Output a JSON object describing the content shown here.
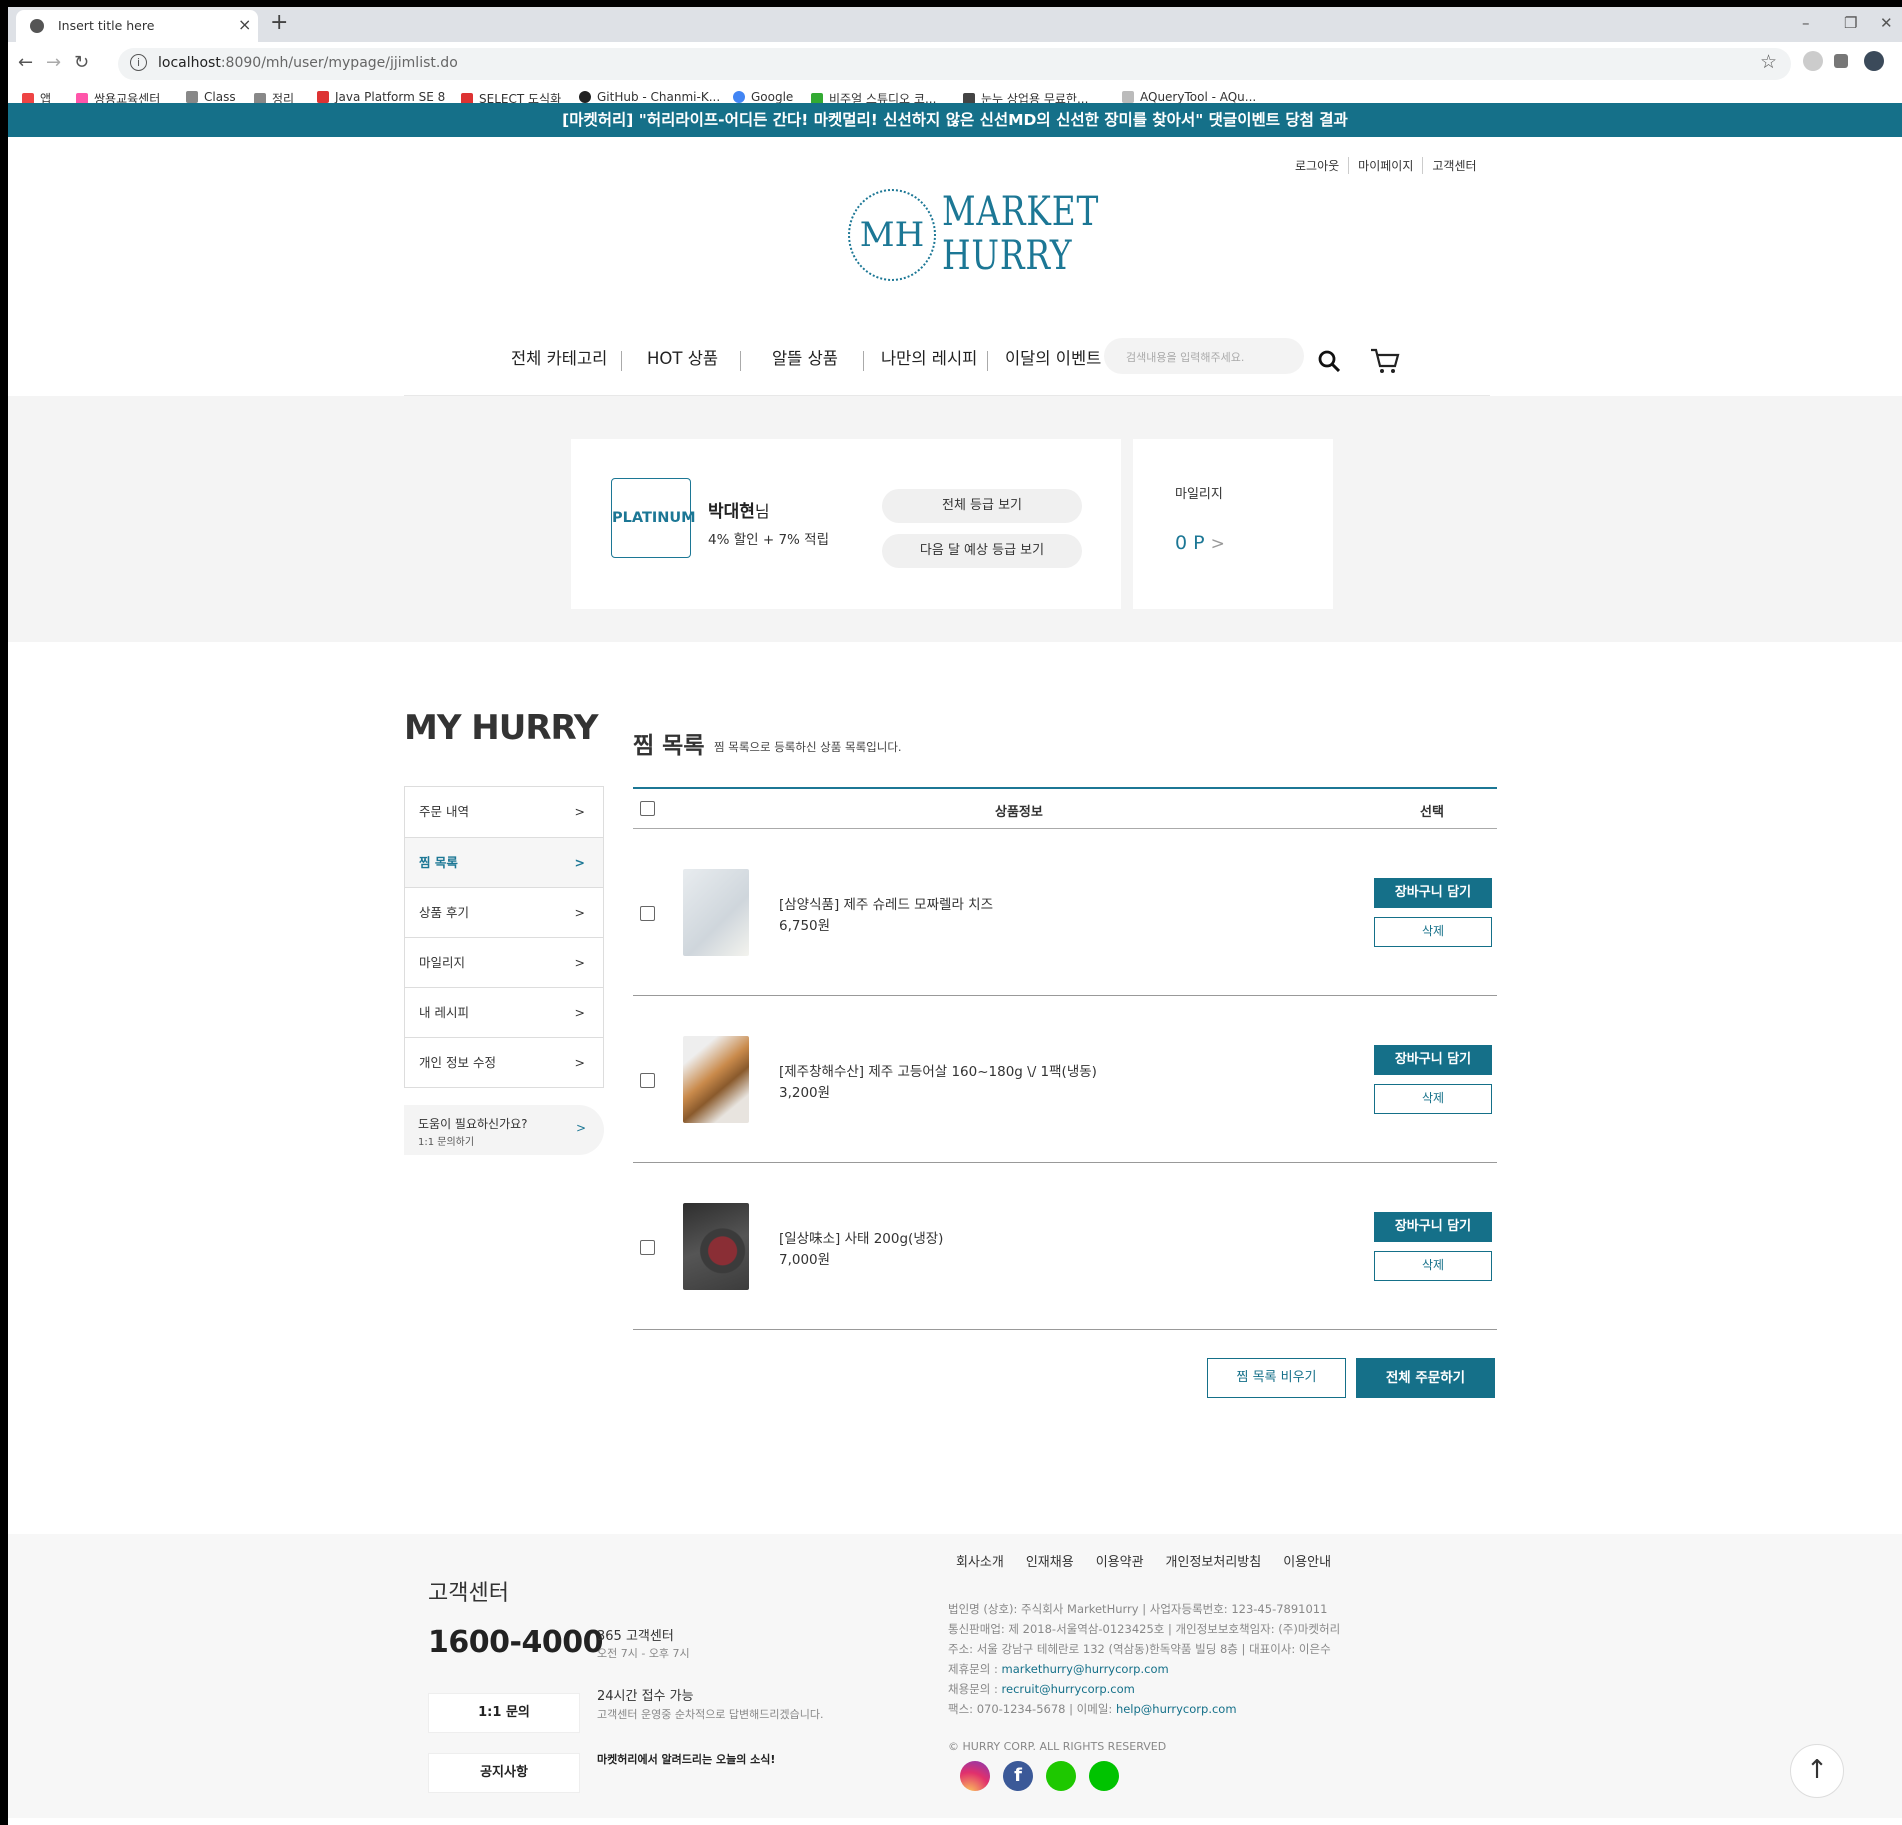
{
  "browser": {
    "tab_title": "Insert title here",
    "url_host": "localhost",
    "url_rest": ":8090/mh/user/mypage/jjimlist.do",
    "bookmarks": [
      "앱",
      "쌍용교육센터",
      "Class",
      "정리",
      "Java Platform SE 8",
      "SELECT 도식화",
      "GitHub - Chanmi-K...",
      "Google",
      "비주얼 스튜디오 코...",
      "눈누 상업용 무료한...",
      "AQueryTool - AQu..."
    ]
  },
  "banner": "[마켓허리] \"허리라이프-어디든 간다! 마켓멀리! 신선하지 않은 신선MD의 신선한 장미를 찾아서\" 댓글이벤트 당첨 결과",
  "util": [
    "로그아웃",
    "마이페이지",
    "고객센터"
  ],
  "logo": {
    "mark": "MH",
    "line1": "MARKET",
    "line2": "HURRY"
  },
  "gnb": [
    "전체 카테고리",
    "HOT 상품",
    "알뜰 상품",
    "나만의 레시피",
    "이달의 이벤트"
  ],
  "search_placeholder": "검색내용을 입력해주세요.",
  "grade": {
    "badge": "PLATINUM",
    "name": "박대현",
    "suffix": "님",
    "benefit": "4% 할인 + 7% 적립",
    "btn_all": "전체 등급 보기",
    "btn_next": "다음 달 예상 등급 보기"
  },
  "mileage": {
    "label": "마일리지",
    "value": "0 P",
    "arrow": ">"
  },
  "my_title": "MY HURRY",
  "lnb": [
    {
      "label": "주문 내역",
      "arrow": ">"
    },
    {
      "label": "찜 목록",
      "arrow": ">"
    },
    {
      "label": "상품 후기",
      "arrow": ">"
    },
    {
      "label": "마일리지",
      "arrow": ">"
    },
    {
      "label": "내 레시피",
      "arrow": ">"
    },
    {
      "label": "개인 정보 수정",
      "arrow": ">"
    }
  ],
  "help": {
    "title": "도움이 필요하신가요?",
    "sub": "1:1 문의하기",
    "arrow": ">"
  },
  "content": {
    "title": "찜 목록",
    "desc": "찜 목록으로 등록하신 상품 목록입니다.",
    "col_info": "상품정보",
    "col_select": "선택",
    "cart_label": "장바구니 담기",
    "delete_label": "삭제",
    "items": [
      {
        "name": "[삼양식품] 제주 슈레드 모짜렐라 치즈",
        "price": "6,750원"
      },
      {
        "name": "[제주창해수산] 제주 고등어살 160~180g \\/ 1팩(냉동)",
        "price": "3,200원"
      },
      {
        "name": "[일상味소] 사태 200g(냉장)",
        "price": "7,000원"
      }
    ],
    "empty_label": "찜 목록 비우기",
    "order_label": "전체 주문하기"
  },
  "footer": {
    "cc_title": "고객센터",
    "tel": "1600-4000",
    "tel_title": "365 고객센터",
    "tel_hours": "오전 7시 - 오후 7시",
    "qna_btn": "1:1 문의",
    "qna_title": "24시간 접수 가능",
    "qna_desc": "고객센터 운영중 순차적으로 답변해드리겠습니다.",
    "notice_btn": "공지사항",
    "notice_desc": "마켓허리에서 알려드리는 오늘의 소식!",
    "links": [
      "회사소개",
      "인재채용",
      "이용약관",
      "개인정보처리방침",
      "이용안내"
    ],
    "info1": "법인명 (상호): 주식회사 MarketHurry  |  사업자등록번호: 123-45-7891011",
    "info2": "통신판매업: 제 2018-서울역삼-0123425호  |  개인정보보호책임자: (주)마켓허리",
    "info3": "주소: 서울 강남구 테헤란로 132 (역삼동)한독약품 빌딩 8층  |  대표이사: 이은수",
    "info4_label": "제휴문의 : ",
    "info4_mail": "markethurry@hurrycorp.com",
    "info5_label": "채용문의 : ",
    "info5_mail": "recruit@hurrycorp.com",
    "info6_label": "팩스: 070-1234-5678  |  이메일: ",
    "info6_mail": "help@hurrycorp.com",
    "copyright": "© HURRY CORP. ALL RIGHTS RESERVED"
  },
  "colors": {
    "primary": "#157089",
    "banner": "#157089"
  }
}
